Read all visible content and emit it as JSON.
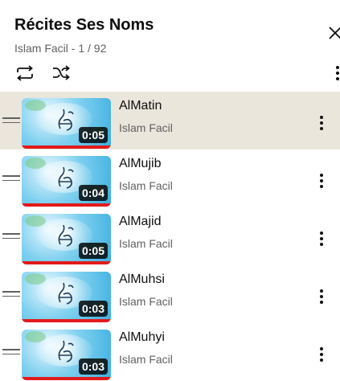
{
  "playlist": {
    "title": "Récites Ses Noms",
    "subtitle": "Islam Facil - 1 / 92"
  },
  "controls": {
    "loop_icon": "loop-icon",
    "shuffle_icon": "shuffle-icon",
    "menu_icon": "more-vert-icon",
    "close_icon": "close-icon"
  },
  "colors": {
    "active_row_bg": "#ebe6dc",
    "progress_red": "#e21a1a",
    "secondary_text": "#606060"
  },
  "videos": [
    {
      "title": "AlMatin",
      "channel": "Islam Facil",
      "duration": "0:05",
      "active": true
    },
    {
      "title": "AlMujib",
      "channel": "Islam Facil",
      "duration": "0:04",
      "active": false
    },
    {
      "title": "AlMajid",
      "channel": "Islam Facil",
      "duration": "0:05",
      "active": false
    },
    {
      "title": "AlMuhsi",
      "channel": "Islam Facil",
      "duration": "0:03",
      "active": false
    },
    {
      "title": "AlMuhyi",
      "channel": "Islam Facil",
      "duration": "0:03",
      "active": false
    }
  ]
}
